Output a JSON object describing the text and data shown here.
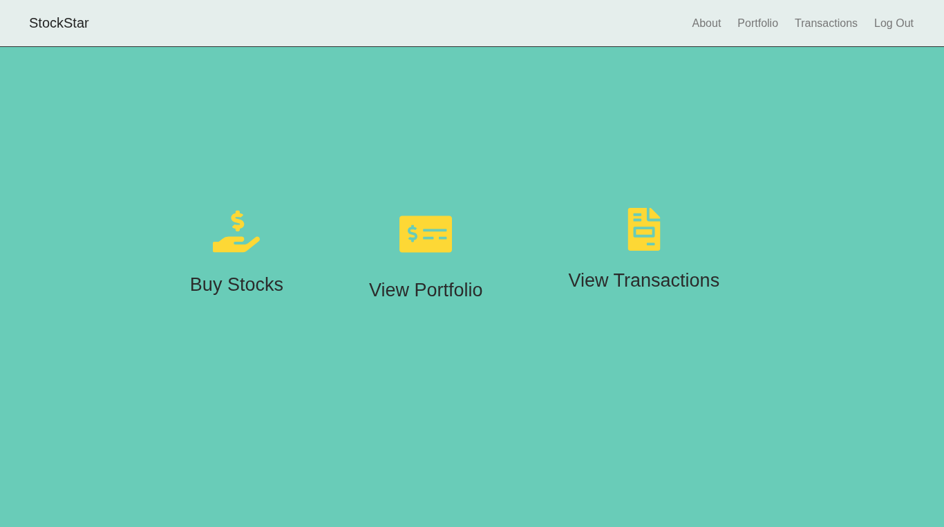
{
  "navbar": {
    "brand": "StockStar",
    "links": [
      "About",
      "Portfolio",
      "Transactions",
      "Log Out"
    ]
  },
  "actions": [
    {
      "kind": "buy",
      "label": "Buy Stocks"
    },
    {
      "kind": "portfolio",
      "label": "View Portfolio"
    },
    {
      "kind": "transactions",
      "label": "View Transactions"
    }
  ]
}
